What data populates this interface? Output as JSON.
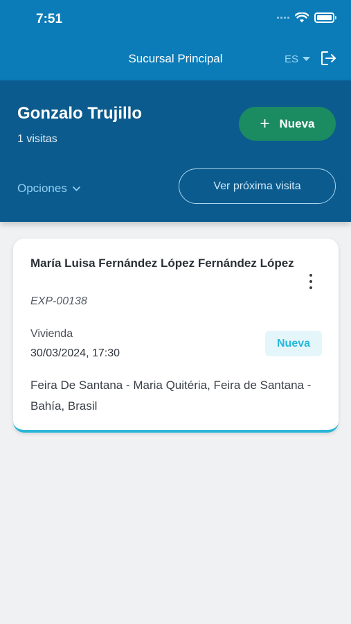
{
  "status_bar": {
    "time": "7:51"
  },
  "header": {
    "branch": "Sucursal Principal",
    "language": "ES"
  },
  "user": {
    "name": "Gonzalo Trujillo",
    "visit_count": "1 visitas"
  },
  "actions": {
    "new_label": "Nueva",
    "options_label": "Opciones",
    "next_visit_label": "Ver próxima visita"
  },
  "visits": [
    {
      "name": "María Luisa Fernández López Fernández López",
      "code": "EXP-00138",
      "type": "Vivienda",
      "datetime": "30/03/2024, 17:30",
      "status": "Nueva",
      "address": "Feira De Santana - Maria Quitéria, Feira de Santana - Bahía, Brasil"
    }
  ],
  "colors": {
    "topbar": "#0b7cb8",
    "panel": "#0c5b8e",
    "new_button": "#1b8b62",
    "badge_text": "#24b7da",
    "card_accent": "#2ab6d8"
  }
}
